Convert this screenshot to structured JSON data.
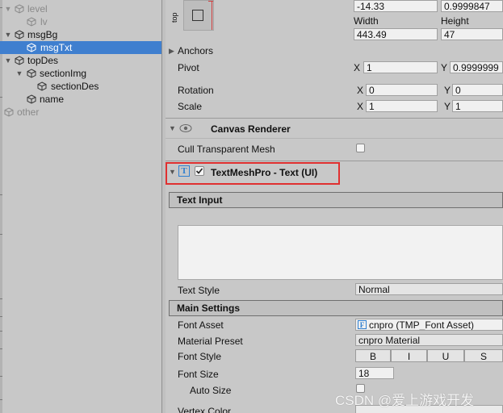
{
  "hierarchy": {
    "items": [
      {
        "label": "level"
      },
      {
        "label": "lv"
      },
      {
        "label": "msgBg"
      },
      {
        "label": "msgTxt"
      },
      {
        "label": "topDes"
      },
      {
        "label": "sectionImg"
      },
      {
        "label": "sectionDes"
      },
      {
        "label": "name"
      },
      {
        "label": "other"
      }
    ]
  },
  "rect_transform": {
    "top_label": "top",
    "pos_y": "-14.33",
    "pos_z": "0.9999847",
    "width_label": "Width",
    "height_label": "Height",
    "width": "443.49",
    "height": "47",
    "anchors_label": "Anchors",
    "pivot_label": "Pivot",
    "pivot_x_label": "X",
    "pivot_x": "1",
    "pivot_y_label": "Y",
    "pivot_y": "0.9999999",
    "rotation_label": "Rotation",
    "rot_x_label": "X",
    "rot_x": "0",
    "rot_y_label": "Y",
    "rot_y": "0",
    "scale_label": "Scale",
    "scale_x_label": "X",
    "scale_x": "1",
    "scale_y_label": "Y",
    "scale_y": "1"
  },
  "canvas_renderer": {
    "title": "Canvas Renderer",
    "cull_label": "Cull Transparent Mesh",
    "cull_checked": false
  },
  "tmp": {
    "title": "TextMeshPro - Text (UI)",
    "enabled": true,
    "highlight_color": "#e03030",
    "text_input_header": "Text Input",
    "text_input_value": "",
    "text_style_label": "Text Style",
    "text_style_value": "Normal",
    "main_settings_header": "Main Settings",
    "font_asset_label": "Font Asset",
    "font_asset_value": "cnpro (TMP_Font Asset)",
    "material_preset_label": "Material Preset",
    "material_preset_value": "cnpro Material",
    "font_style_label": "Font Style",
    "style_buttons": [
      "B",
      "I",
      "U",
      "S"
    ],
    "font_size_label": "Font Size",
    "font_size_value": "18",
    "auto_size_label": "Auto Size",
    "auto_size_checked": false,
    "vertex_color_label": "Vertex Color"
  },
  "watermark": "CSDN @爱上游戏开发"
}
